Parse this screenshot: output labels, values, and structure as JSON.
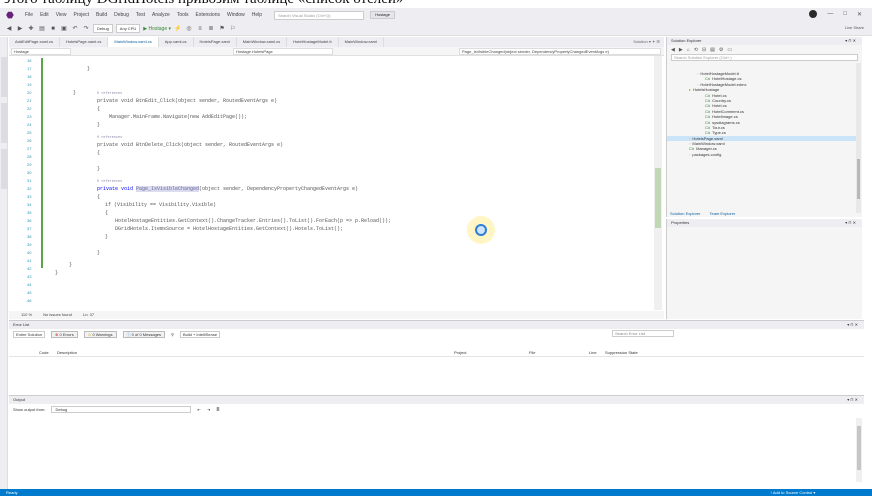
{
  "caption": "этого таблицу DGridHotels привозим таблице «список отелей»",
  "menu": {
    "items": [
      "File",
      "Edit",
      "View",
      "Project",
      "Build",
      "Debug",
      "Test",
      "Analyze",
      "Tools",
      "Extensions",
      "Window",
      "Help"
    ],
    "search_placeholder": "Search Visual Studio (Ctrl+Q)",
    "title_badge": "Hostage"
  },
  "toolbar": {
    "config": "Debug",
    "platform": "Any CPU",
    "start_label": "▶ Hostage ▾",
    "liveshare": "Live Share"
  },
  "editor_tabs": {
    "tabs": [
      {
        "label": "AddEditPage.xaml.cs",
        "active": false
      },
      {
        "label": "HotelsPage.xaml.cs",
        "active": false
      },
      {
        "label": "MainWindow.xaml.cs",
        "active": true
      },
      {
        "label": "App.xaml.cs",
        "active": false
      },
      {
        "label": "HotelsPage.xaml",
        "active": false
      },
      {
        "label": "MainWindow.xaml.cs",
        "active": false
      },
      {
        "label": "HotelHostageModel.tt",
        "active": false
      },
      {
        "label": "MainWindow.xaml",
        "active": false
      }
    ],
    "right_label": "Solution ▾ ✦ ☰"
  },
  "navbar": {
    "project": "Hostage",
    "class": "Hostage.HotelsPage",
    "member": "Page_IsVisibleChanged(object sender, DependencyPropertyChangedEventArgs e)"
  },
  "editor": {
    "line_numbers": [
      "16",
      "17",
      "18",
      "19",
      "20",
      "21",
      "22",
      "23",
      "24",
      "25",
      "26",
      "27",
      "28",
      "29",
      "30",
      "31",
      "32",
      "33",
      "34",
      "35",
      "36",
      "37",
      "38",
      "39",
      "40",
      "41",
      "42",
      "43",
      "44",
      "45",
      "46"
    ],
    "code": {
      "btn_edit_sig": "private void BtnEdit_Click(object sender, RoutedEventArgs e)",
      "navigate_line": "Manager.MainFrame.Navigate(new AddEditPage());",
      "btn_delete_sig": "private void BtnDelete_Click(object sender, RoutedEventArgs e)",
      "refs": "0 references",
      "visible_sig_pre": "private void ",
      "visible_sig_name": "Page_IsVisibleChanged",
      "visible_sig_post": "(object sender, DependencyPropertyChangedEventArgs e)",
      "if_line": "if (Visibility == Visibility.Visible)",
      "reload_line": "HotelHostageEntities.GetContext().ChangeTracker.Entries().ToList().ForEach(p => p.Reload());",
      "itemsource_line": "DGridHotels.ItemsSource = HotelHostageEntities.GetContext().Hotels.ToList();"
    }
  },
  "editor_status": {
    "zoom": "110 %",
    "issues": "No issues found",
    "position": "Ln: 37"
  },
  "error_list": {
    "title": "Error List",
    "scope": "Entire Solution",
    "errors": "0 Errors",
    "warnings": "0 Warnings",
    "messages": "0 of 0 Messages",
    "build_filter": "Build + IntelliSense",
    "search_placeholder": "Search Error List",
    "columns": [
      "Code",
      "Description",
      "Project",
      "File",
      "Line",
      "Suppression State"
    ]
  },
  "output": {
    "title": "Output",
    "show_from_label": "Show output from:",
    "source": "Debug"
  },
  "solution_explorer": {
    "title": "Solution Explorer",
    "search_placeholder": "Search Solution Explorer (Ctrl+;)",
    "tree": [
      {
        "label": "HotelHostageModel.tt",
        "indent": 12,
        "kind": "file",
        "selected": false
      },
      {
        "label": "HotelHostage.cs",
        "indent": 16,
        "kind": "cs",
        "selected": false
      },
      {
        "label": "HotelHostageModel.edmx",
        "indent": 12,
        "kind": "file",
        "selected": false
      },
      {
        "label": "HotelsHostage",
        "indent": 8,
        "kind": "folder",
        "selected": false
      },
      {
        "label": "Hotel.cs",
        "indent": 16,
        "kind": "cs",
        "selected": false
      },
      {
        "label": "Country.cs",
        "indent": 16,
        "kind": "cs",
        "selected": false
      },
      {
        "label": "Hotel.cs",
        "indent": 16,
        "kind": "cs",
        "selected": false
      },
      {
        "label": "HotelComment.cs",
        "indent": 16,
        "kind": "cs",
        "selected": false
      },
      {
        "label": "HotelImage.cs",
        "indent": 16,
        "kind": "cs",
        "selected": false
      },
      {
        "label": "sysdiagrams.cs",
        "indent": 16,
        "kind": "cs",
        "selected": false
      },
      {
        "label": "Tour.cs",
        "indent": 16,
        "kind": "cs",
        "selected": false
      },
      {
        "label": "Type.cs",
        "indent": 16,
        "kind": "cs",
        "selected": false
      },
      {
        "label": "HotelsPage.xaml",
        "indent": 8,
        "kind": "file",
        "selected": true
      },
      {
        "label": "MainWindow.xaml",
        "indent": 8,
        "kind": "file",
        "selected": false
      },
      {
        "label": "Manager.cs",
        "indent": 8,
        "kind": "cs",
        "selected": false
      },
      {
        "label": "packages.config",
        "indent": 8,
        "kind": "file",
        "selected": false
      }
    ],
    "tabs": [
      "Solution Explorer",
      "Team Explorer"
    ]
  },
  "properties": {
    "title": "Properties"
  },
  "statusbar": {
    "ready": "Ready",
    "add_source": "↑ Add to Source Control ▾"
  }
}
